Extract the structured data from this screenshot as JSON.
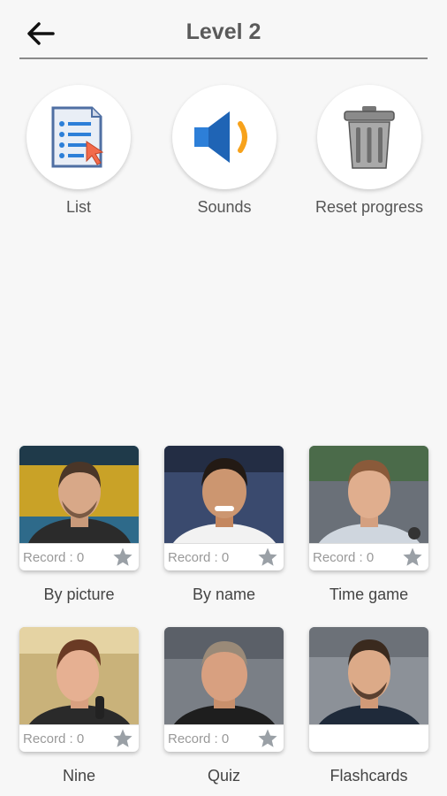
{
  "header": {
    "title": "Level 2"
  },
  "actions": [
    {
      "label": "List",
      "icon": "list-icon"
    },
    {
      "label": "Sounds",
      "icon": "speaker-icon"
    },
    {
      "label": "Reset progress",
      "icon": "trash-icon"
    }
  ],
  "modes": [
    {
      "label": "By picture",
      "record": "Record : 0"
    },
    {
      "label": "By name",
      "record": "Record : 0"
    },
    {
      "label": "Time game",
      "record": "Record : 0"
    },
    {
      "label": "Nine",
      "record": "Record : 0"
    },
    {
      "label": "Quiz",
      "record": "Record : 0"
    },
    {
      "label": "Flashcards",
      "record": ""
    }
  ],
  "colors": {
    "background": "#f7f7f7",
    "accent_blue": "#2d7fd8",
    "accent_orange": "#f7a21b",
    "star_grey": "#9aa0a6"
  }
}
